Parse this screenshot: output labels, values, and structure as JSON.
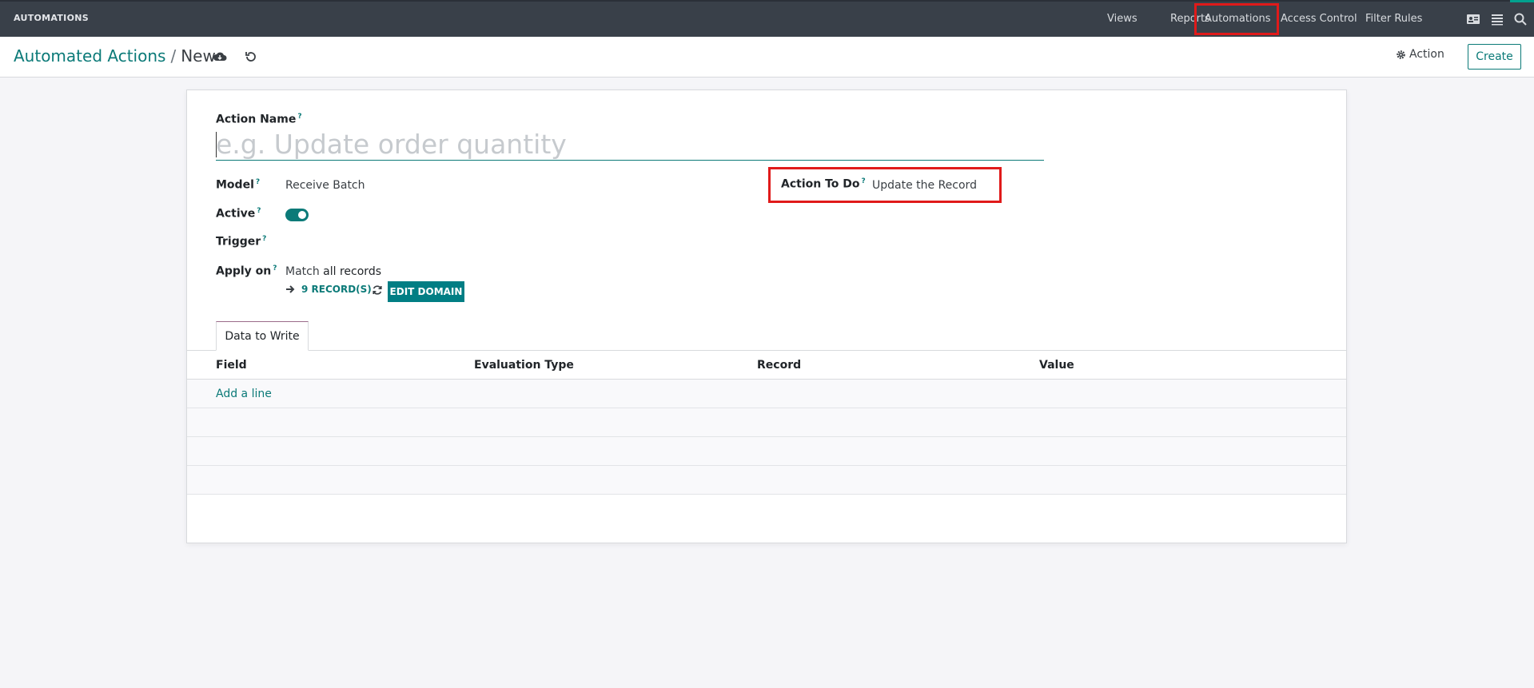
{
  "navbar": {
    "brand": "AUTOMATIONS",
    "menu": [
      "Views",
      "Reports",
      "Automations",
      "Access Control",
      "Filter Rules"
    ],
    "icons": [
      "contact-card-icon",
      "list-icon",
      "search-icon"
    ]
  },
  "control": {
    "breadcrumb_parent": "Automated Actions",
    "breadcrumb_separator": "/",
    "breadcrumb_current": "New",
    "action_label": "Action",
    "create_label": "Create"
  },
  "form": {
    "action_name_label": "Action Name",
    "action_name_placeholder": "e.g. Update order quantity",
    "action_name_value": "",
    "help_mark": "?",
    "model_label": "Model",
    "model_value": "Receive Batch",
    "active_label": "Active",
    "active_value": true,
    "trigger_label": "Trigger",
    "trigger_value": "",
    "apply_on_label": "Apply on",
    "apply_on_prefix": "Match",
    "apply_on_emphasis": "all records",
    "records_link": "9 RECORD(S)",
    "edit_domain_label": "EDIT DOMAIN",
    "action_to_do_label": "Action To Do",
    "action_to_do_value": "Update the Record"
  },
  "tabs": [
    {
      "label": "Data to Write"
    }
  ],
  "table": {
    "columns": [
      "Field",
      "Evaluation Type",
      "Record",
      "Value"
    ],
    "add_line": "Add a line"
  },
  "colors": {
    "navbar": "#394049",
    "accent": "#0b7a78",
    "primary_button": "#017e84",
    "highlight": "#e01a1a"
  }
}
